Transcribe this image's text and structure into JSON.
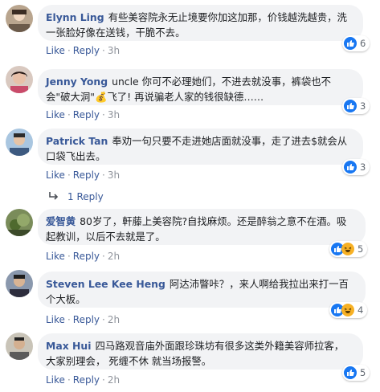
{
  "action_labels": {
    "like": "Like",
    "reply": "Reply",
    "separator": "·"
  },
  "comments": [
    {
      "author": "Elynn Ling",
      "text": "有些美容院永无止境要你加这加那，价钱越洗越贵，洗一张脸好像在送钱，干脆不去。",
      "time": "3h",
      "reactions": [
        "like"
      ],
      "reaction_count": "6"
    },
    {
      "author": "Jenny Yong",
      "text": "uncle  你可不必理她们，不进去就没事，裤袋也不会\"破大洞\"💰飞了! 再说骗老人家的钱很缺德……",
      "time": "3h",
      "reactions": [
        "like"
      ],
      "reaction_count": "3"
    },
    {
      "author": "Patrick Tan",
      "text": "奉劝一句只要不走进她店面就没事，走了进去$就会从口袋飞出去。",
      "time": "3h",
      "reactions": [
        "like"
      ],
      "reaction_count": "3"
    },
    {
      "author": "爱智黄",
      "text": "80岁了，軒藤上美容院?自找麻烦。还是醉翁之意不在酒。吸起教训，以后不去就是了。",
      "time": "2h",
      "reactions": [
        "like",
        "haha"
      ],
      "reaction_count": "5"
    },
    {
      "author": "Steven Lee Kee Heng",
      "text": "阿达沛瞥咔？，来人啊给我拉出来打一百个大板。",
      "time": "2h",
      "reactions": [
        "like",
        "haha"
      ],
      "reaction_count": "4"
    },
    {
      "author": "Max Hui",
      "text": "四马路观音庙外面跟珍珠坊有很多这类外籍美容师拉客，大家别理会， 死缠不休 就当场报警。",
      "time": "2h",
      "reactions": [
        "like"
      ],
      "reaction_count": "5"
    }
  ],
  "replies_link": {
    "label": "1 Reply"
  },
  "colors": {
    "link": "#385898",
    "bubble": "#f2f3f5",
    "like_blue": "#1877f2",
    "haha_yellow": "#f7b125",
    "muted": "#90949c"
  }
}
